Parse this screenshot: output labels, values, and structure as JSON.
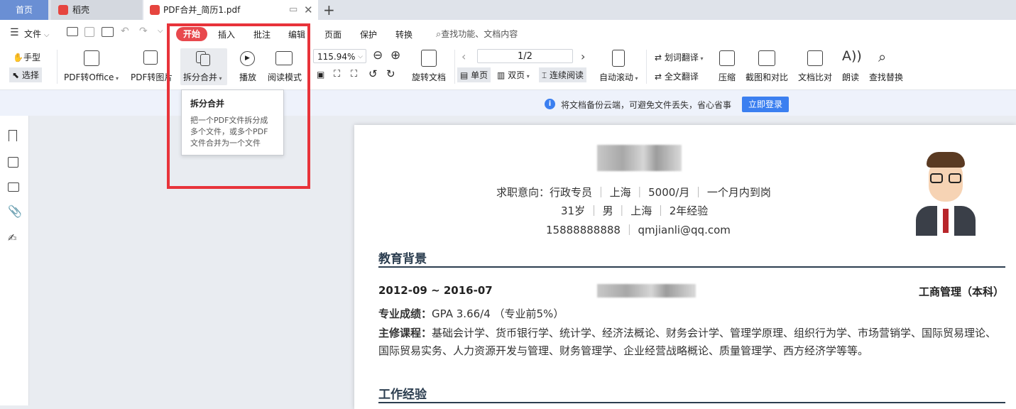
{
  "tabs": {
    "home": "首页",
    "daoke": "稻壳",
    "doc": "PDF合并_简历1.pdf"
  },
  "menu": {
    "file": "文件",
    "items": [
      "开始",
      "插入",
      "批注",
      "编辑",
      "页面",
      "保护",
      "转换"
    ],
    "search": "查找功能、文档内容"
  },
  "toolbar": {
    "hand": "手型",
    "select": "选择",
    "pdf_to_office": "PDF转Office",
    "pdf_to_image": "PDF转图片",
    "split_merge": "拆分合并",
    "play": "播放",
    "read_mode": "阅读模式",
    "zoom": "115.94%",
    "rotate": "旋转文档",
    "page_indicator": "1/2",
    "single": "单页",
    "double": "双页",
    "continuous": "连续阅读",
    "auto_scroll": "自动滚动",
    "word_translate": "划词翻译",
    "full_translate": "全文翻译",
    "compress": "压缩",
    "screenshot_compare": "截图和对比",
    "doc_compare": "文档比对",
    "read_aloud": "朗读",
    "find_replace": "查找替换"
  },
  "tooltip": {
    "title": "拆分合并",
    "body1": "把一个PDF文件拆分成",
    "body2": "多个文件，或多个PDF",
    "body3": "文件合并为一个文件"
  },
  "notice": {
    "text": "将文档备份云端，可避免文件丢失，省心省事",
    "login": "立即登录"
  },
  "resume": {
    "intent_label": "求职意向：行政专员",
    "city": "上海",
    "salary": "5000/月",
    "start": "一个月内到岗",
    "age": "31岁",
    "gender": "男",
    "city2": "上海",
    "exp": "2年经验",
    "phone": "15888888888",
    "email": "qmjianli@qq.com",
    "edu_title": "教育背景",
    "edu_period": "2012-09 ~ 2016-07",
    "edu_major": "工商管理（本科）",
    "grade_label": "专业成绩：",
    "grade": "GPA 3.66/4 （专业前5%）",
    "course_label": "主修课程：",
    "course_1": "基础会计学、货币银行学、统计学、经济法概论、财务会计学、管理学原理、组织行为学、市场营销学、国际贸易理论、",
    "course_2": "国际贸易实务、人力资源开发与管理、财务管理学、企业经营战略概论、质量管理学、西方经济学等等。",
    "work_title": "工作经验"
  },
  "colors": {
    "accent_red": "#e8484d",
    "highlight_box": "#e8333a",
    "login_blue": "#3b7ff0",
    "heading": "#2c3e50"
  }
}
